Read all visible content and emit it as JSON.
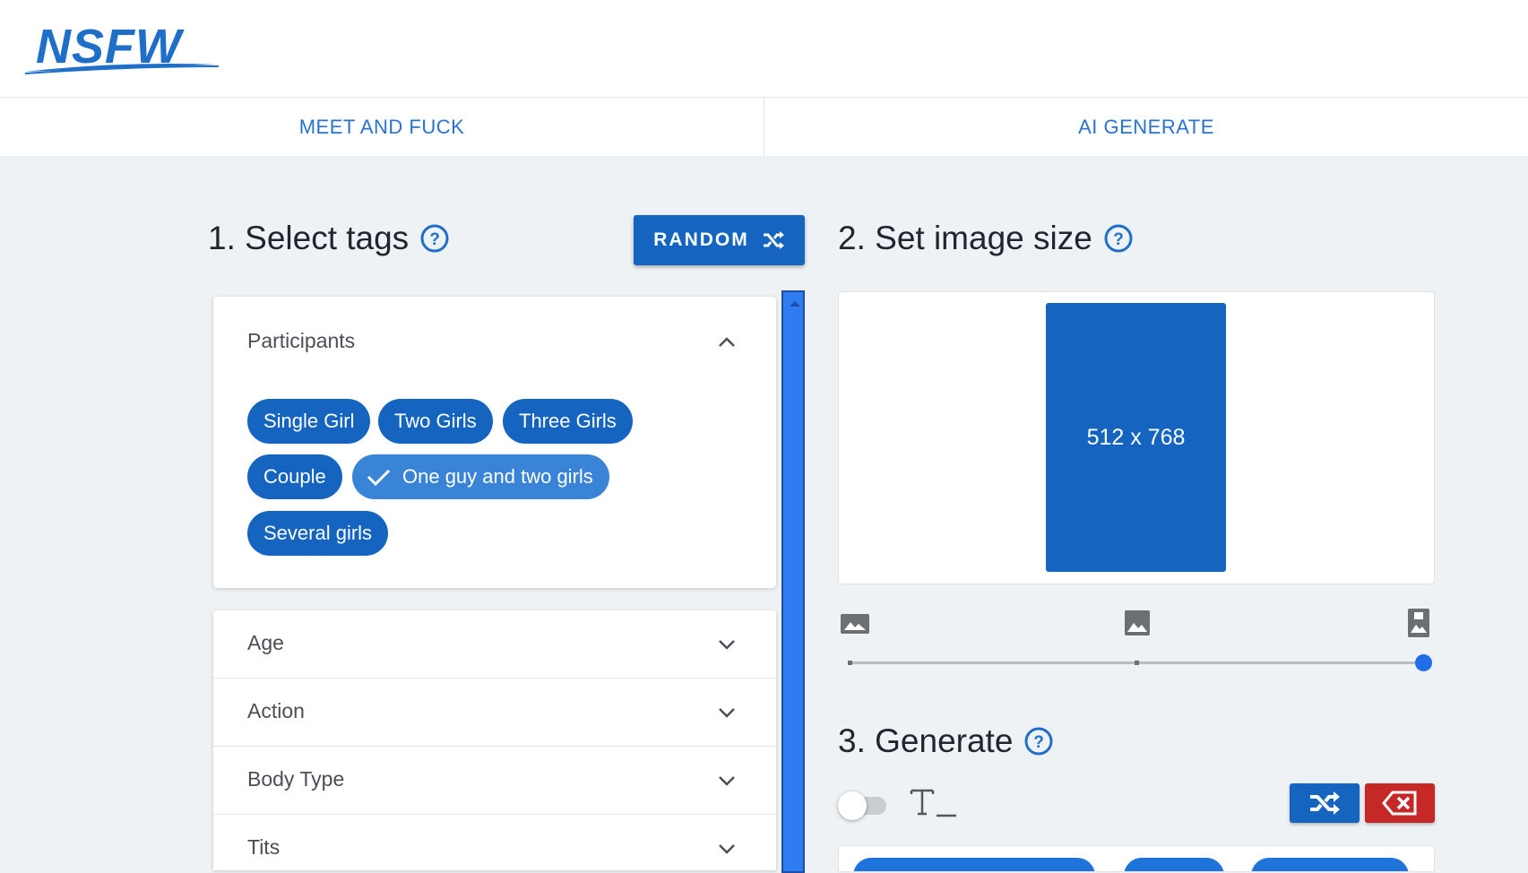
{
  "brand": {
    "logo_text": "NSFW"
  },
  "nav": {
    "tabs": [
      {
        "label": "MEET AND FUCK"
      },
      {
        "label": "AI GENERATE"
      }
    ]
  },
  "step1": {
    "title": "1. Select tags",
    "random_label": "RANDOM",
    "open_panel": {
      "title": "Participants",
      "chips": [
        {
          "label": "Single Girl",
          "selected": false
        },
        {
          "label": "Two Girls",
          "selected": false
        },
        {
          "label": "Three Girls",
          "selected": false
        },
        {
          "label": "Couple",
          "selected": false
        },
        {
          "label": "One guy and two girls",
          "selected": true
        },
        {
          "label": "Several girls",
          "selected": false
        }
      ]
    },
    "collapsed_panels": [
      {
        "title": "Age"
      },
      {
        "title": "Action"
      },
      {
        "title": "Body Type"
      },
      {
        "title": "Tits"
      }
    ]
  },
  "step2": {
    "title": "2. Set image size",
    "size_label": "512 x 768",
    "size_options": [
      "landscape-image-icon",
      "square-image-icon",
      "portrait-image-icon"
    ],
    "selected_size_index": 2
  },
  "step3": {
    "title": "3. Generate",
    "text_mode_enabled": false
  },
  "colors": {
    "primary": "#1565c0",
    "danger": "#c62828",
    "accent": "#2a72d0",
    "background": "#eef2f5"
  }
}
